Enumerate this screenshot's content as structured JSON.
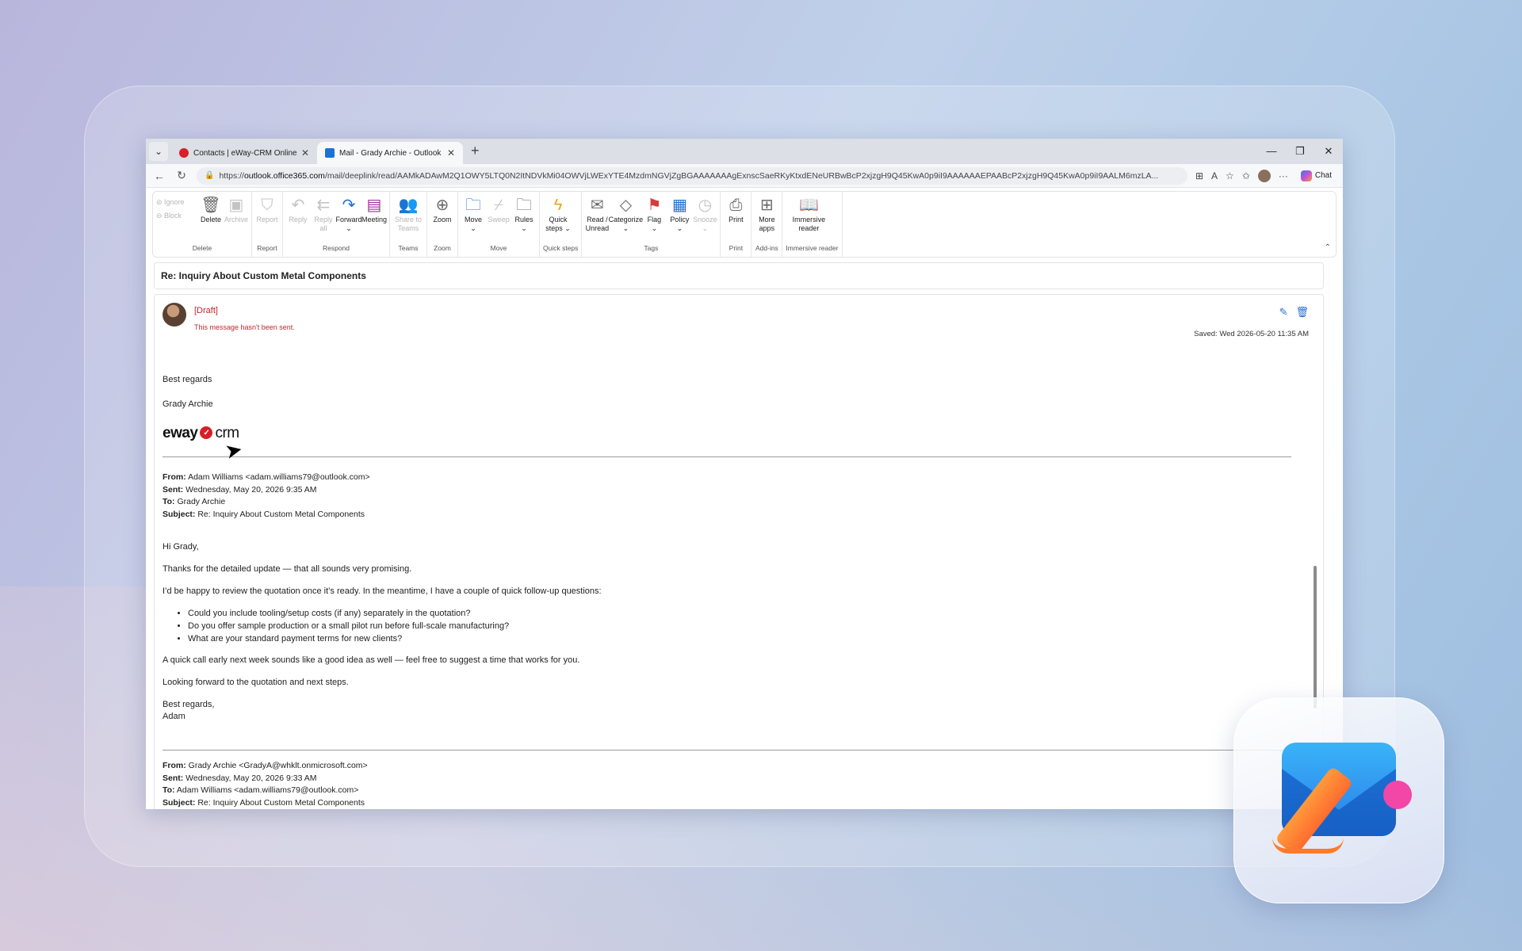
{
  "tabs": [
    {
      "title": "Contacts | eWay-CRM Online",
      "favicon": "eway-favicon",
      "active": false
    },
    {
      "title": "Mail - Grady Archie - Outlook",
      "favicon": "outlook-favicon",
      "active": true
    }
  ],
  "address": {
    "prefix": "https://",
    "domain": "outlook.office365.com",
    "path": "/mail/deeplink/read/AAMkADAwM2Q1OWY5LTQ0N2ItNDVkMi04OWVjLWExYTE4MzdmNGVjZgBGAAAAAAAgExnscSaeRKyKtxdENeURBwBcP2xjzgH9Q45KwA0p9iI9AAAAAAEPAABcP2xjzgH9Q45KwA0p9iI9AALM6mzLA...",
    "chat_label": "Chat"
  },
  "ribbon": {
    "delete": {
      "ignore": "Ignore",
      "block": "Block",
      "delete": "Delete",
      "archive": "Archive",
      "label": "Delete"
    },
    "report": {
      "report": "Report",
      "label": "Report"
    },
    "respond": {
      "reply": "Reply",
      "reply_all_1": "Reply",
      "reply_all_2": "all",
      "forward": "Forward",
      "meeting": "Meeting",
      "label": "Respond"
    },
    "teams": {
      "share1": "Share to",
      "share2": "Teams",
      "label": "Teams"
    },
    "zoom": {
      "zoom": "Zoom",
      "label": "Zoom"
    },
    "move": {
      "move": "Move",
      "sweep": "Sweep",
      "rules": "Rules",
      "label": "Move"
    },
    "quicksteps": {
      "q1": "Quick",
      "q2": "steps",
      "label": "Quick steps"
    },
    "tags": {
      "read1": "Read /",
      "read2": "Unread",
      "categorize": "Categorize",
      "flag": "Flag",
      "policy": "Policy",
      "snooze": "Snooze",
      "label": "Tags"
    },
    "print": {
      "print": "Print",
      "label": "Print"
    },
    "addins": {
      "more1": "More",
      "more2": "apps",
      "label": "Add-ins"
    },
    "immersive": {
      "i1": "Immersive",
      "i2": "reader",
      "label": "Immersive reader"
    }
  },
  "message": {
    "subject": "Re: Inquiry About Custom Metal Components",
    "draft_label": "[Draft]",
    "draft_note": "This message hasn't been sent.",
    "saved": "Saved: Wed 2026-05-20 11:35 AM",
    "signoff": "Best regards",
    "sender_name": "Grady Archie",
    "logo": {
      "left": "eway",
      "right": "crm"
    },
    "quoted1": {
      "from_label": "From:",
      "from": "Adam Williams <adam.williams79@outlook.com>",
      "sent_label": "Sent:",
      "sent": "Wednesday, May 20, 2026 9:35 AM",
      "to_label": "To:",
      "to": "Grady Archie",
      "subject_label": "Subject:",
      "subject": "Re: Inquiry About Custom Metal Components",
      "greeting": "Hi Grady,",
      "p1": "Thanks for the detailed update — that all sounds very promising.",
      "p2": "I’d be happy to review the quotation once it’s ready. In the meantime, I have a couple of quick follow-up questions:",
      "bullets": [
        "Could you include tooling/setup costs (if any) separately in the quotation?",
        "Do you offer sample production or a small pilot run before full-scale manufacturing?",
        "What are your standard payment terms for new clients?"
      ],
      "p3": "A quick call early next week sounds like a good idea as well — feel free to suggest a time that works for you.",
      "p4": "Looking forward to the quotation and next steps.",
      "signoff": "Best regards,",
      "name": "Adam"
    },
    "quoted2": {
      "from_label": "From:",
      "from": "Grady Archie <GradyA@whklt.onmicrosoft.com>",
      "sent_label": "Sent:",
      "sent": "Wednesday, May 20, 2026 9:33 AM",
      "to_label": "To:",
      "to": "Adam Williams <adam.williams79@outlook.com>",
      "subject_label": "Subject:",
      "subject": "Re: Inquiry About Custom Metal Components"
    }
  }
}
